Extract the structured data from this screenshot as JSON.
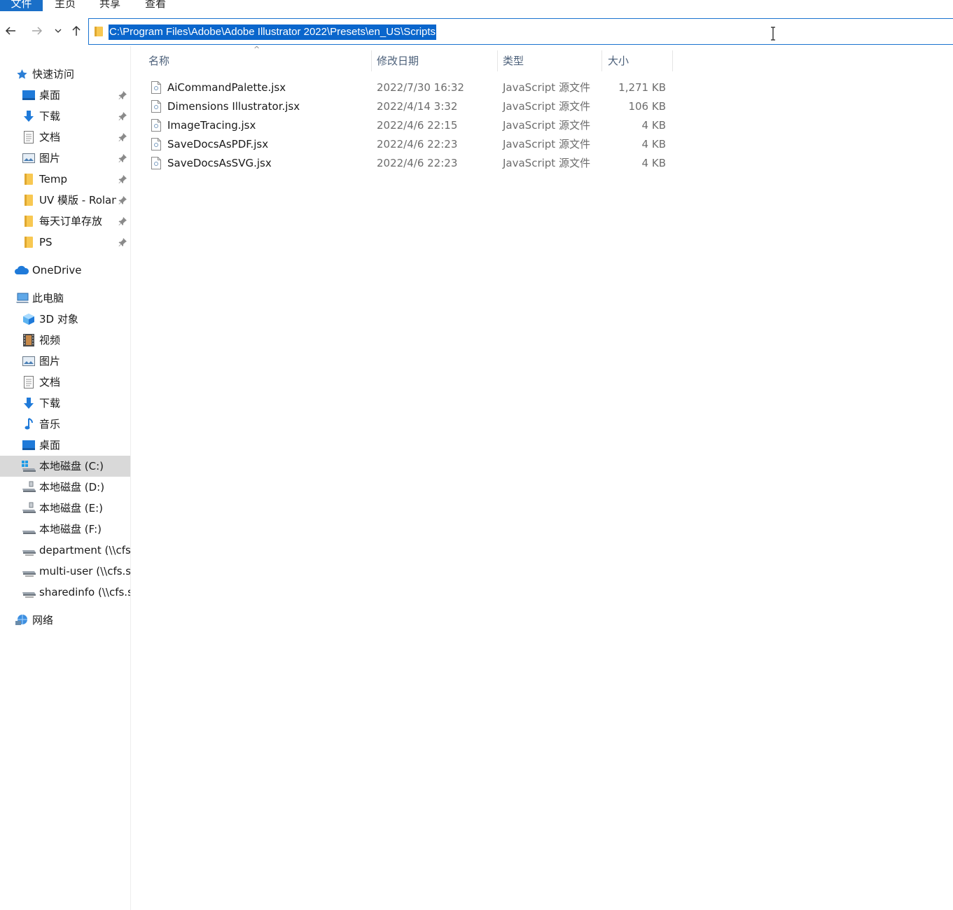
{
  "ribbon": {
    "tabs": [
      "文件",
      "主页",
      "共享",
      "查看"
    ]
  },
  "navigation": {
    "back_icon": "arrow-left",
    "forward_icon": "arrow-right",
    "recent_icon": "chevron-down",
    "up_icon": "arrow-up",
    "address_path": "C:\\Program Files\\Adobe\\Adobe Illustrator 2022\\Presets\\en_US\\Scripts"
  },
  "sidebar": {
    "quick_access": {
      "label": "快速访问",
      "items": [
        {
          "label": "桌面",
          "icon": "desktop",
          "pinned": true
        },
        {
          "label": "下载",
          "icon": "download",
          "pinned": true
        },
        {
          "label": "文档",
          "icon": "document",
          "pinned": true
        },
        {
          "label": "图片",
          "icon": "pictures",
          "pinned": true
        },
        {
          "label": "Temp",
          "icon": "folder",
          "pinned": true
        },
        {
          "label": "UV 模版 - Rolan",
          "icon": "folder",
          "pinned": true
        },
        {
          "label": "每天订单存放",
          "icon": "folder",
          "pinned": true
        },
        {
          "label": "PS",
          "icon": "folder",
          "pinned": true
        }
      ]
    },
    "onedrive": {
      "label": "OneDrive"
    },
    "this_pc": {
      "label": "此电脑",
      "items": [
        {
          "label": "3D 对象",
          "icon": "3d-objects"
        },
        {
          "label": "视频",
          "icon": "videos"
        },
        {
          "label": "图片",
          "icon": "pictures"
        },
        {
          "label": "文档",
          "icon": "document"
        },
        {
          "label": "下载",
          "icon": "download"
        },
        {
          "label": "音乐",
          "icon": "music"
        },
        {
          "label": "桌面",
          "icon": "desktop"
        },
        {
          "label": "本地磁盘 (C:)",
          "icon": "windows-drive",
          "selected": true
        },
        {
          "label": "本地磁盘 (D:)",
          "icon": "drive"
        },
        {
          "label": "本地磁盘 (E:)",
          "icon": "drive"
        },
        {
          "label": "本地磁盘 (F:)",
          "icon": "drive-plain"
        },
        {
          "label": "department (\\\\cfs.",
          "icon": "network-drive"
        },
        {
          "label": "multi-user (\\\\cfs.sh",
          "icon": "network-drive"
        },
        {
          "label": "sharedinfo (\\\\cfs.s",
          "icon": "network-drive"
        }
      ]
    },
    "network": {
      "label": "网络"
    }
  },
  "file_list": {
    "columns": {
      "name": "名称",
      "date": "修改日期",
      "type": "类型",
      "size": "大小"
    },
    "sort_indicator": "^",
    "rows": [
      {
        "name": "AiCommandPalette.jsx",
        "date": "2022/7/30 16:32",
        "type": "JavaScript 源文件",
        "size": "1,271 KB"
      },
      {
        "name": "Dimensions Illustrator.jsx",
        "date": "2022/4/14 3:32",
        "type": "JavaScript 源文件",
        "size": "106 KB"
      },
      {
        "name": "ImageTracing.jsx",
        "date": "2022/4/6 22:15",
        "type": "JavaScript 源文件",
        "size": "4 KB"
      },
      {
        "name": "SaveDocsAsPDF.jsx",
        "date": "2022/4/6 22:23",
        "type": "JavaScript 源文件",
        "size": "4 KB"
      },
      {
        "name": "SaveDocsAsSVG.jsx",
        "date": "2022/4/6 22:23",
        "type": "JavaScript 源文件",
        "size": "4 KB"
      }
    ]
  },
  "colors": {
    "accent": "#1a6fc8",
    "selection": "#0a66cc",
    "folder": "#f8c852",
    "selected_row": "#d9d9d9"
  }
}
